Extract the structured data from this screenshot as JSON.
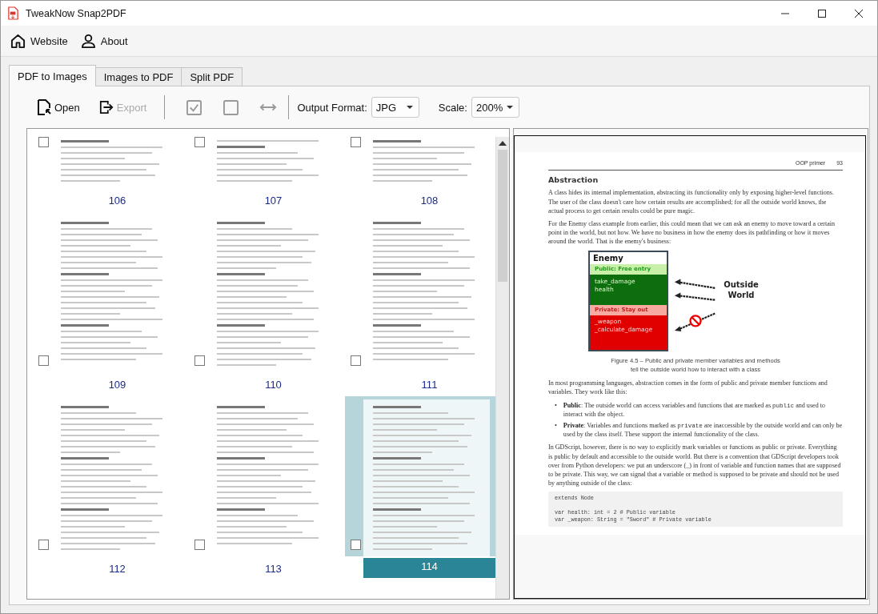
{
  "window": {
    "title": "TweakNow Snap2PDF"
  },
  "menu": [
    {
      "label": "Website"
    },
    {
      "label": "About"
    }
  ],
  "tabs": [
    {
      "label": "PDF to Images",
      "selected": true
    },
    {
      "label": "Images to PDF",
      "selected": false
    },
    {
      "label": "Split PDF",
      "selected": false
    }
  ],
  "toolbar": {
    "open": {
      "label": "Open",
      "disabled": false
    },
    "export": {
      "label": "Export",
      "disabled": true
    },
    "check_all": {
      "disabled": true
    },
    "uncheck_all": {
      "disabled": true
    },
    "invert": {
      "disabled": true
    },
    "output_format": {
      "label": "Output Format:",
      "value": "JPG"
    },
    "scale": {
      "label": "Scale:",
      "value": "200%"
    }
  },
  "thumbnails": [
    {
      "page": "106",
      "checked": false,
      "selected": false
    },
    {
      "page": "107",
      "checked": false,
      "selected": false
    },
    {
      "page": "108",
      "checked": false,
      "selected": false
    },
    {
      "page": "109",
      "checked": false,
      "selected": false
    },
    {
      "page": "110",
      "checked": false,
      "selected": false
    },
    {
      "page": "111",
      "checked": false,
      "selected": false
    },
    {
      "page": "112",
      "checked": false,
      "selected": false
    },
    {
      "page": "113",
      "checked": false,
      "selected": false
    },
    {
      "page": "114",
      "checked": false,
      "selected": true
    }
  ],
  "preview": {
    "running_head": "OOP primer",
    "page_number": "93",
    "heading": "Abstraction",
    "paragraphs_before": [
      "A class hides its internal implementation, abstracting its functionality only by exposing higher-level functions. The user of the class doesn't care how certain results are accomplished; for all the outside world knows, the actual process to get certain results could be pure magic.",
      "For the Enemy class example from earlier, this could mean that we can ask an enemy to move toward a certain point in the world, but not how. We have no business in how the enemy does its pathfinding or how it moves around the world. That is the enemy's business:"
    ],
    "figure": {
      "class_name": "Enemy",
      "public_label": "Public: Free entry",
      "public_members": [
        "take_damage",
        "health"
      ],
      "private_label": "Private: Stay out",
      "private_members": [
        "_weapon",
        "_calculate_damage"
      ],
      "outside_label": "Outside World"
    },
    "caption": [
      "Figure 4.5 – Public and private member variables and methods",
      "tell the outside world how to interact with a class"
    ],
    "intro": "In most programming languages, abstraction comes in the form of public and private member functions and variables. They work like this:",
    "bullets": [
      {
        "marker": "•",
        "label": "Public",
        "before": ": The outside world can access variables and functions that are marked as",
        "code": "public",
        "after": "and used to interact with the object."
      },
      {
        "marker": "•",
        "label": "Private",
        "before": ": Variables and functions marked as",
        "code": "private",
        "after": "are inaccessible by the outside world and can only be used by the class itself. These support the internal functionality of the class."
      }
    ],
    "paragraph_after": "In GDScript, however, there is no way to explicitly mark variables or functions as public or private. Everything is public by default and accessible to the outside world. But there is a convention that GDScript developers took over from Python developers: we put an underscore (_) in front of variable and function names that are supposed to be private. This way, we can signal that a variable or method is supposed to be private and should not be used by anything outside of the class:",
    "code": [
      "extends Node",
      "var health: int = 2 # Public variable",
      "var _weapon: String = \"Sword\" # Private variable"
    ]
  }
}
